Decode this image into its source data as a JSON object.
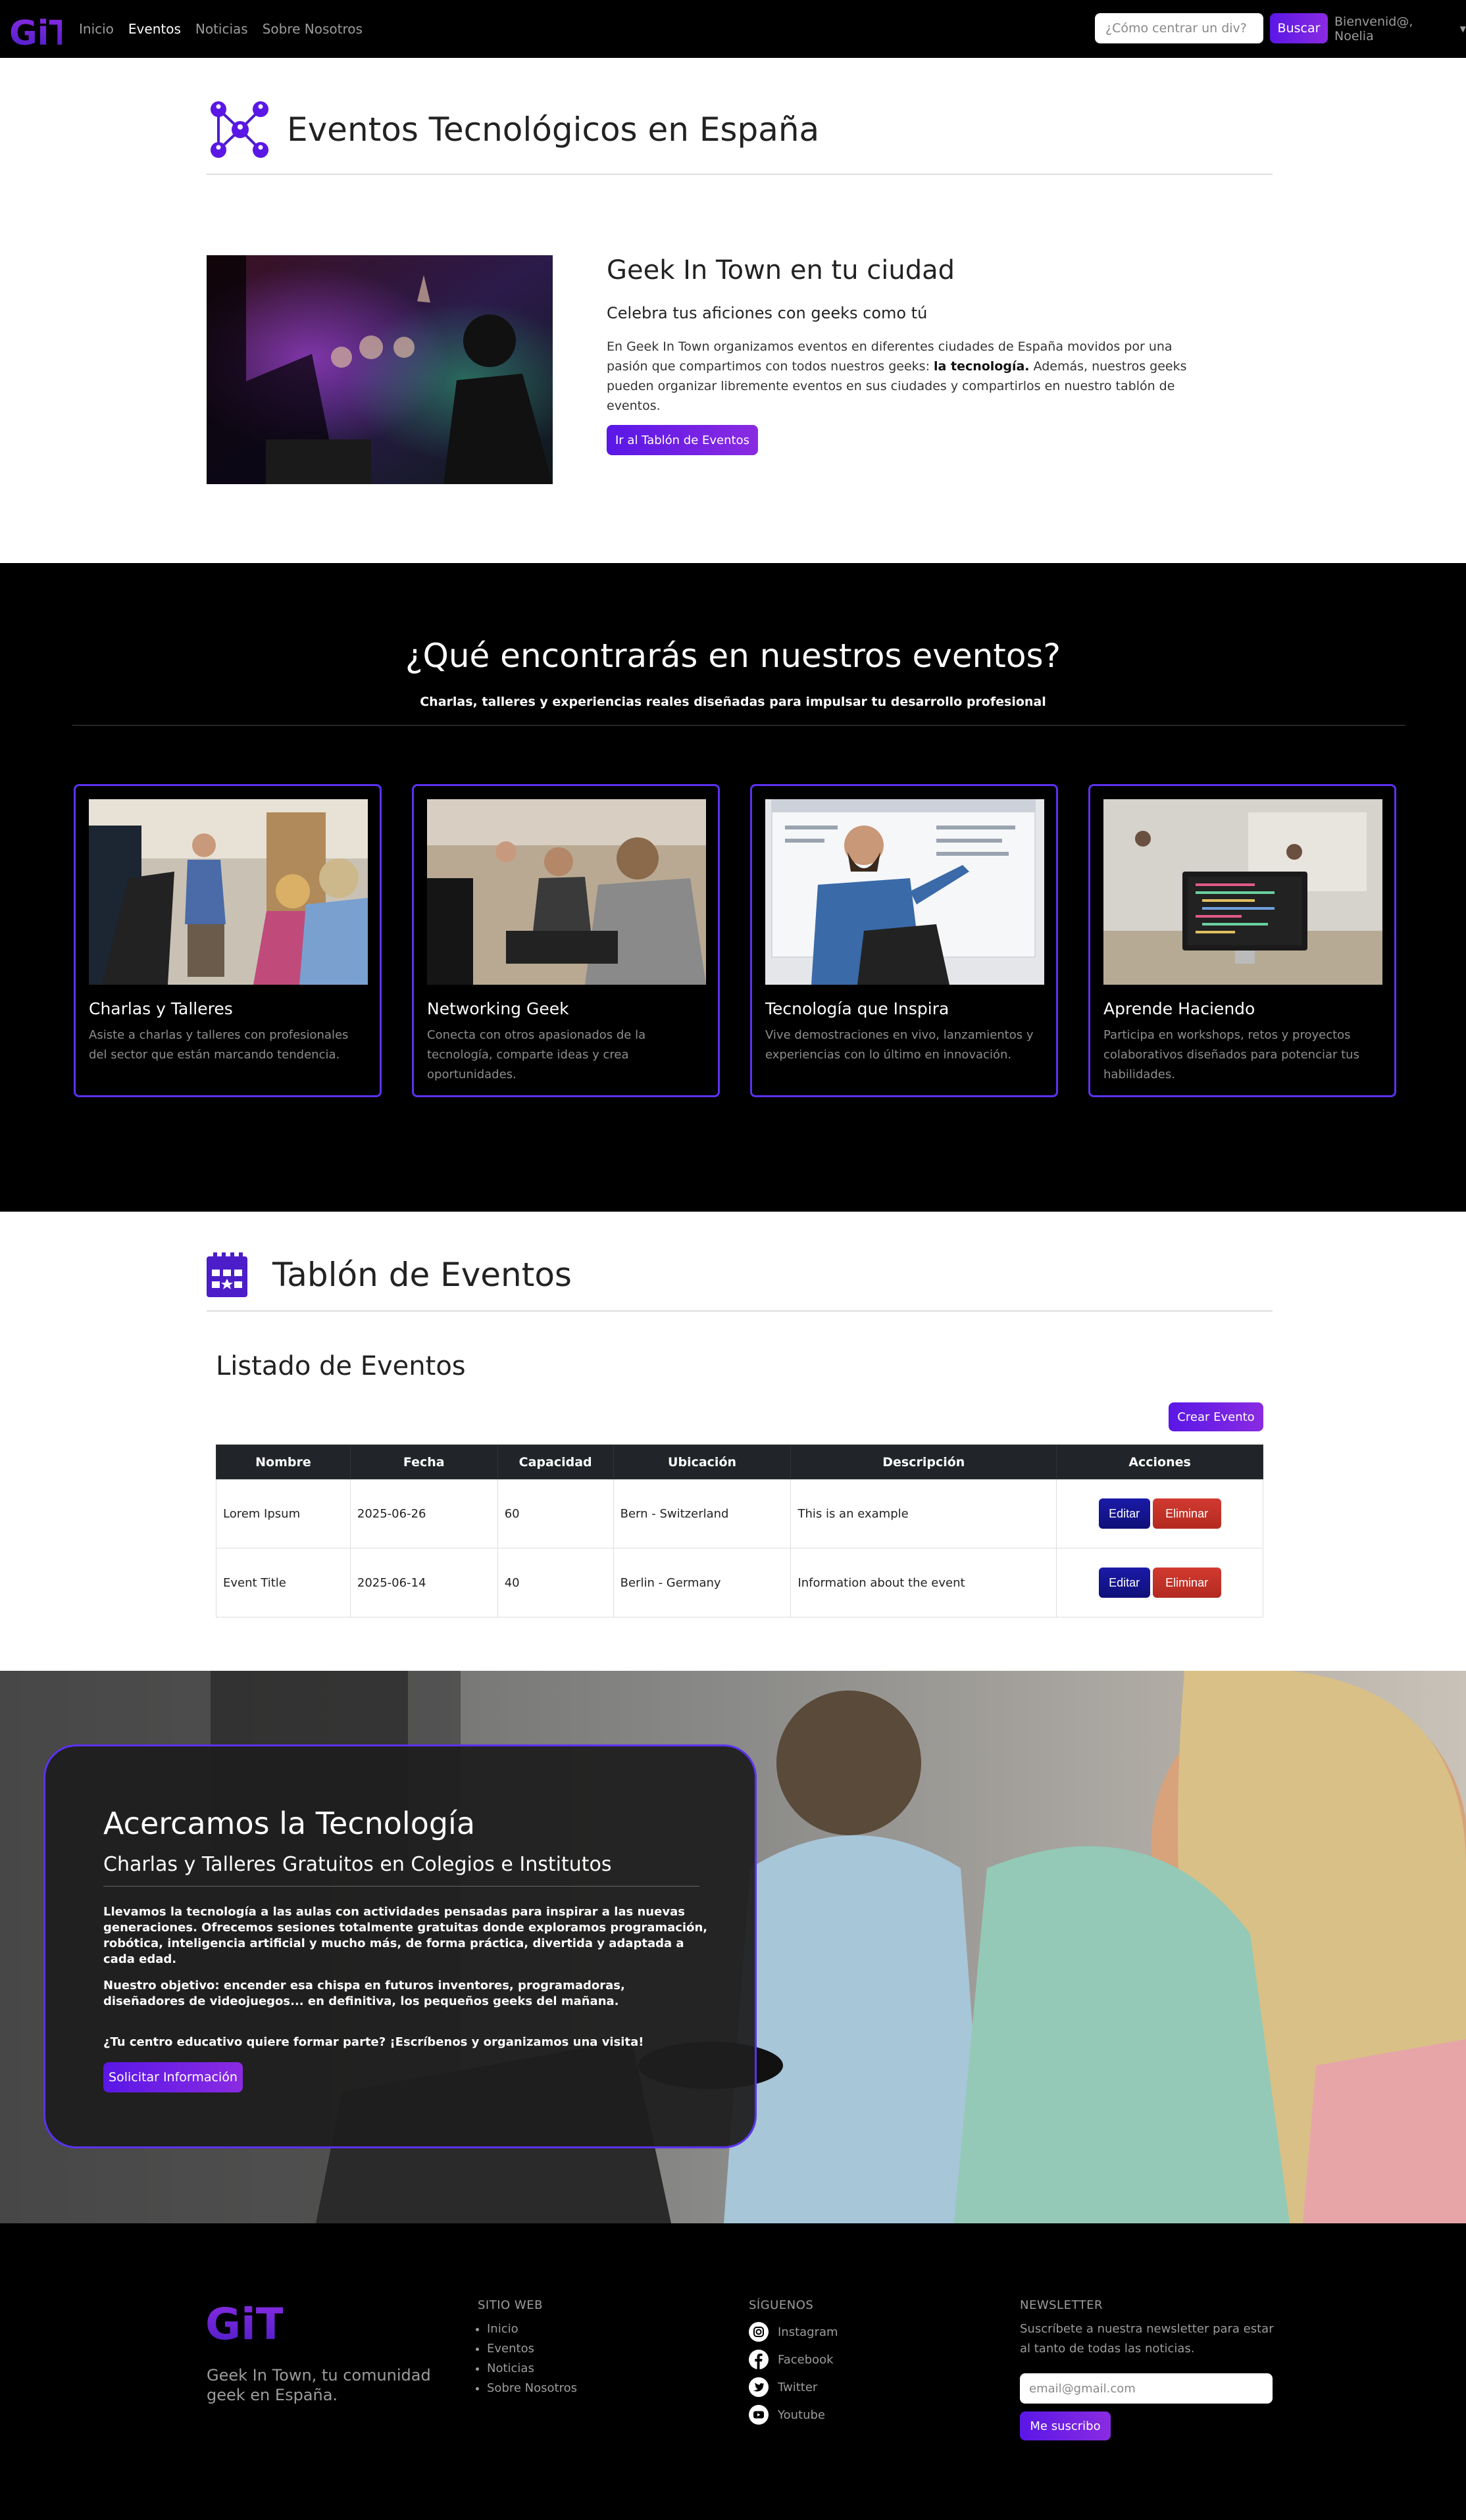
{
  "nav": {
    "logo_text": "GiT",
    "links": [
      "Inicio",
      "Eventos",
      "Noticias",
      "Sobre Nosotros"
    ],
    "active": "Eventos",
    "search_placeholder": "¿Cómo centrar un div?",
    "search_button": "Buscar",
    "user_label": "Bienvenid@, Noelia"
  },
  "header": {
    "title": "Eventos Tecnológicos en España",
    "icon": "network-people-icon"
  },
  "hero": {
    "title": "Geek In Town en tu ciudad",
    "subtitle": "Celebra tus aficiones con geeks como tú",
    "text_before": "En Geek In Town organizamos eventos en diferentes ciudades de España movidos por una pasión que compartimos con todos nuestros geeks: ",
    "text_bold": "la tecnología.",
    "text_after": " Además, nuestros geeks pueden organizar libremente eventos en sus ciudades y compartirlos en nuestro tablón de eventos.",
    "button": "Ir al Tablón de Eventos"
  },
  "features": {
    "title": "¿Qué encontrarás en nuestros eventos?",
    "subtitle": "Charlas, talleres y experiencias reales diseñadas para impulsar tu desarrollo profesional",
    "cards": [
      {
        "title": "Charlas y Talleres",
        "text": "Asiste a charlas y talleres con profesionales del sector que están marcando tendencia."
      },
      {
        "title": "Networking Geek",
        "text": "Conecta con otros apasionados de la tecnología, comparte ideas y crea oportunidades."
      },
      {
        "title": "Tecnología que Inspira",
        "text": "Vive demostraciones en vivo, lanzamientos y experiencias con lo último en innovación."
      },
      {
        "title": "Aprende Haciendo",
        "text": "Participa en workshops, retos y proyectos colaborativos diseñados para potenciar tus habilidades."
      }
    ]
  },
  "board": {
    "title": "Tablón de Eventos",
    "icon": "calendar-icon",
    "list_title": "Listado de Eventos",
    "create_button": "Crear Evento",
    "columns": [
      "Nombre",
      "Fecha",
      "Capacidad",
      "Ubicación",
      "Descripción",
      "Acciones"
    ],
    "rows": [
      {
        "name": "Lorem Ipsum",
        "date": "2025-06-26",
        "capacity": "60",
        "location": "Bern - Switzerland",
        "description": "This is an example"
      },
      {
        "name": "Event Title",
        "date": "2025-06-14",
        "capacity": "40",
        "location": "Berlin - Germany",
        "description": "Information about the event"
      }
    ],
    "edit_label": "Editar",
    "delete_label": "Eliminar"
  },
  "school": {
    "title": "Acercamos la Tecnología",
    "subtitle": "Charlas y Talleres Gratuitos en Colegios e Institutos",
    "p1": "Llevamos la tecnología a las aulas con actividades pensadas para inspirar a las nuevas generaciones. Ofrecemos sesiones totalmente gratuitas donde exploramos programación, robótica, inteligencia artificial y mucho más, de forma práctica, divertida y adaptada a cada edad.",
    "p2": "Nuestro objetivo: encender esa chispa en futuros inventores, programadoras, diseñadores de videojuegos... en definitiva, los pequeños geeks del mañana.",
    "p3": "¿Tu centro educativo quiere formar parte? ¡Escríbenos y organizamos una visita!",
    "button": "Solicitar Información"
  },
  "footer": {
    "logo_text": "GiT",
    "tagline": "Geek In Town, tu comunidad geek en España.",
    "site_title": "SITIO WEB",
    "site_links": [
      "Inicio",
      "Eventos",
      "Noticias",
      "Sobre Nosotros"
    ],
    "follow_title": "SÍGUENOS",
    "social": [
      "Instagram",
      "Facebook",
      "Twitter",
      "Youtube"
    ],
    "newsletter_title": "NEWSLETTER",
    "newsletter_text": "Suscríbete a nuestra newsletter para estar al tanto de todas las noticias.",
    "email_placeholder": "email@gmail.com",
    "subscribe_button": "Me suscribo"
  },
  "colors": {
    "accent": "#6a1fe8",
    "accent2": "#8a2be2",
    "card_border": "#5b32f0",
    "dark": "#000000"
  }
}
